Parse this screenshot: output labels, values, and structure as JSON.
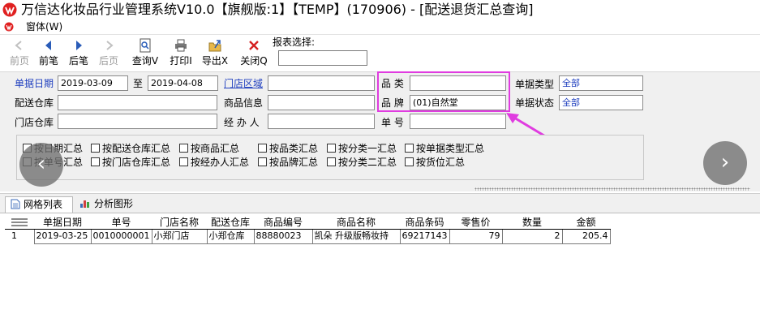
{
  "window": {
    "title": "万信达化妆品行业管理系统V10.0【旗舰版:1】【TEMP】(170906) - [配送退货汇总查询]"
  },
  "menu": {
    "form": "窗体(W)"
  },
  "toolbar": {
    "buttons": [
      {
        "label": "前页",
        "icon": "first-page-icon",
        "enabled": false
      },
      {
        "label": "前笔",
        "icon": "prev-record-icon",
        "enabled": true
      },
      {
        "label": "后笔",
        "icon": "next-record-icon",
        "enabled": true
      },
      {
        "label": "后页",
        "icon": "last-page-icon",
        "enabled": false
      },
      {
        "label": "查询Ⅴ",
        "icon": "query-icon",
        "enabled": true
      },
      {
        "label": "打印Ⅰ",
        "icon": "print-icon",
        "enabled": true
      },
      {
        "label": "导出Ⅹ",
        "icon": "export-icon",
        "enabled": true
      },
      {
        "label": "关闭Q",
        "icon": "close-icon",
        "enabled": true
      }
    ],
    "report_label": "报表选择:",
    "report_value": ""
  },
  "filters": {
    "date_label": "单据日期",
    "date_from": "2019-03-09",
    "date_to_label": "至",
    "date_to": "2019-04-08",
    "store_region_label": "门店区域",
    "store_region": "",
    "category_label": "品  类",
    "category": "",
    "doc_type_label": "单据类型",
    "doc_type": "全部",
    "warehouse_label": "配送仓库",
    "warehouse": "",
    "product_info_label": "商品信息",
    "product_info": "",
    "brand_label": "品  牌",
    "brand": "(01)自然堂",
    "doc_status_label": "单据状态",
    "doc_status": "全部",
    "store_wh_label": "门店仓库",
    "store_wh": "",
    "handler_label": "经 办 人",
    "handler": "",
    "doc_no_label": "单  号",
    "doc_no": ""
  },
  "group_options": [
    {
      "label": "按日期汇总",
      "checked": false
    },
    {
      "label": "按配送仓库汇总",
      "checked": false
    },
    {
      "label": "按商品汇总",
      "checked": false
    },
    {
      "label": "按品类汇总",
      "checked": false
    },
    {
      "label": "按分类一汇总",
      "checked": false
    },
    {
      "label": "按单据类型汇总",
      "checked": false
    },
    {
      "label": "按单号汇总",
      "checked": false
    },
    {
      "label": "按门店仓库汇总",
      "checked": false
    },
    {
      "label": "按经办人汇总",
      "checked": false
    },
    {
      "label": "按品牌汇总",
      "checked": false
    },
    {
      "label": "按分类二汇总",
      "checked": false
    },
    {
      "label": "按货位汇总",
      "checked": false
    }
  ],
  "tabs": [
    {
      "label": "网格列表",
      "active": true
    },
    {
      "label": "分析图形",
      "active": false
    }
  ],
  "grid": {
    "columns": [
      "单据日期",
      "单号",
      "门店名称",
      "配送仓库",
      "商品编号",
      "商品名称",
      "商品条码",
      "零售价",
      "数量",
      "金额"
    ],
    "rows": [
      {
        "rownum": "1",
        "cells": [
          "2019-03-25",
          "0010000001",
          "小郑门店",
          "小郑仓库",
          "88880023",
          "凯朵 升级版畅妆持",
          "69217143",
          "79",
          "2",
          "205.4"
        ]
      }
    ]
  },
  "colors": {
    "highlight": "#e03ce0",
    "label_blue": "#1f3fbf"
  }
}
